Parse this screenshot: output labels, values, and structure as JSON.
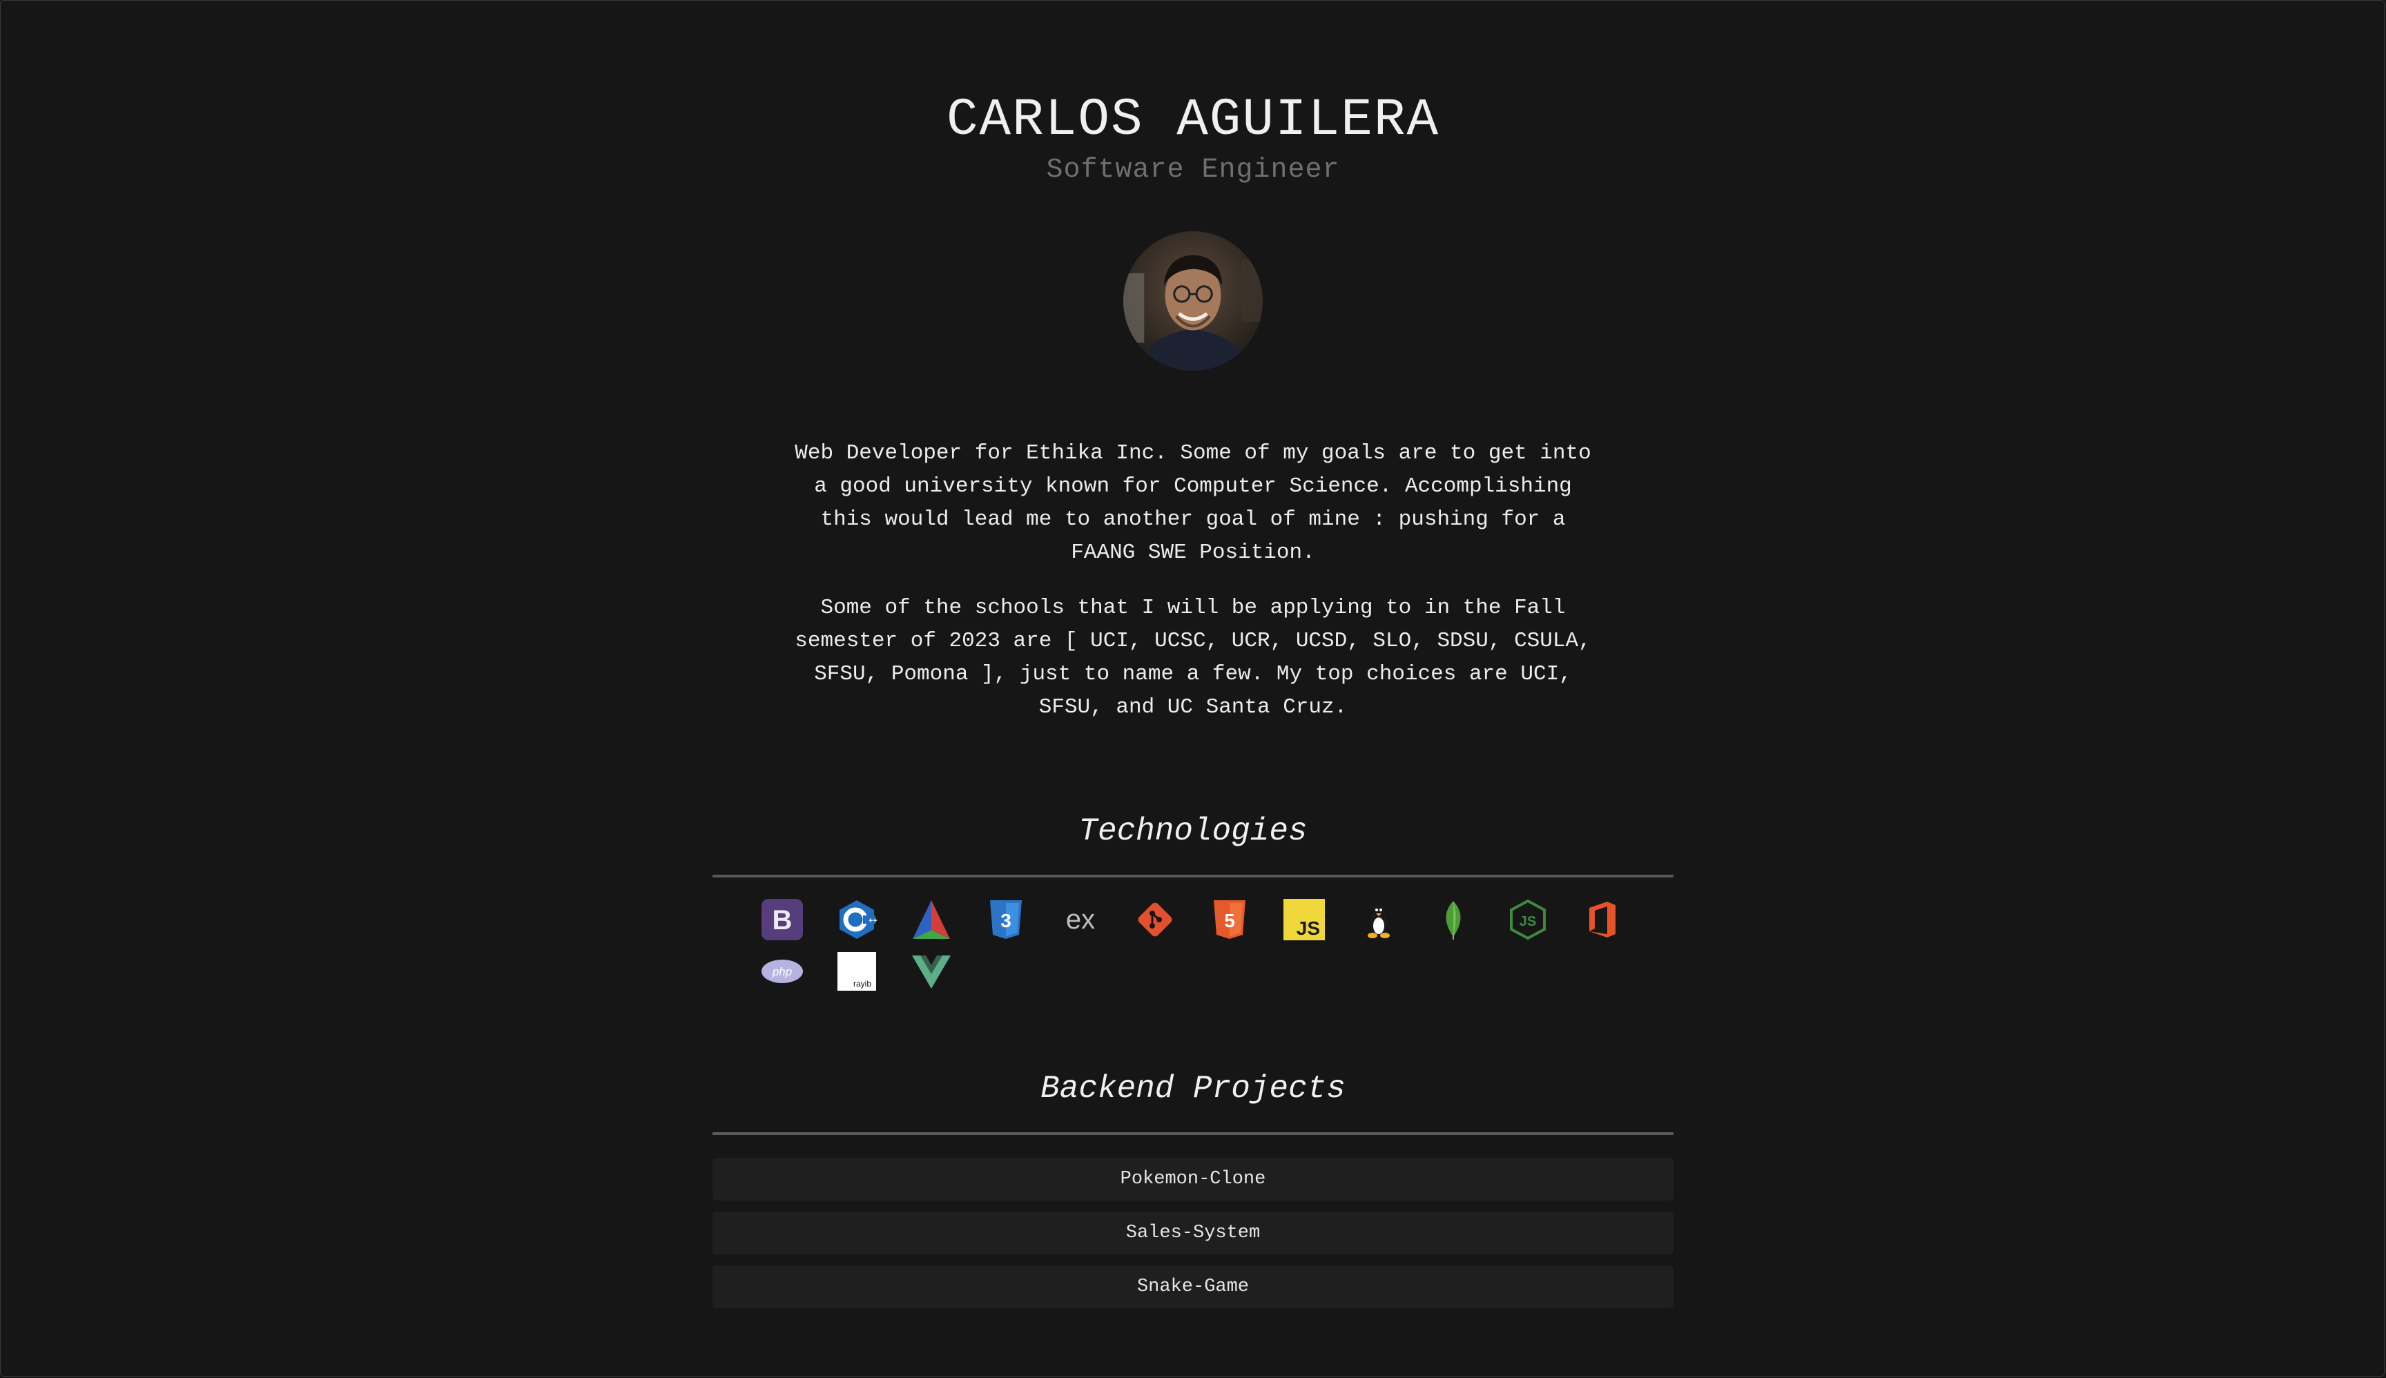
{
  "header": {
    "name": "CARLOS AGUILERA",
    "role": "Software Engineer"
  },
  "avatar": {
    "alt": "Profile photo"
  },
  "bio": {
    "paragraph1": "Web Developer for Ethika Inc. Some of my goals are to get into a good university known for Computer Science. Accomplishing this would lead me to another goal of mine : pushing for a FAANG SWE Position.",
    "paragraph2": "Some of the schools that I will be applying to in the Fall semester of 2023 are [ UCI, UCSC, UCR, UCSD, SLO, SDSU, CSULA, SFSU, Pomona ], just to name a few. My top choices are UCI, SFSU, and UC Santa Cruz."
  },
  "technologies": {
    "title": "Technologies",
    "icons": [
      {
        "name": "bootstrap-icon",
        "label": "B",
        "color": "#563d7c"
      },
      {
        "name": "cplusplus-icon",
        "label": "C++",
        "color": "#1e6fbf"
      },
      {
        "name": "cmake-icon",
        "label": "",
        "color": "#3e8ede"
      },
      {
        "name": "css3-icon",
        "label": "3",
        "color": "#2d74c9"
      },
      {
        "name": "express-icon",
        "label": "ex",
        "color": "#bdbdbd"
      },
      {
        "name": "git-icon",
        "label": "",
        "color": "#e2502e"
      },
      {
        "name": "html5-icon",
        "label": "5",
        "color": "#e55a2b"
      },
      {
        "name": "javascript-icon",
        "label": "JS",
        "color": "#f0d73a"
      },
      {
        "name": "linux-icon",
        "label": "",
        "color": "#ffffff"
      },
      {
        "name": "mongodb-icon",
        "label": "",
        "color": "#4f9b3b"
      },
      {
        "name": "nodejs-icon",
        "label": "JS",
        "color": "#3e8a3e"
      },
      {
        "name": "office-icon",
        "label": "",
        "color": "#e4532a"
      },
      {
        "name": "php-icon",
        "label": "php",
        "color": "#b6b3e0"
      },
      {
        "name": "rayib-icon",
        "label": "rayib",
        "color": "#ffffff"
      },
      {
        "name": "vuejs-icon",
        "label": "",
        "color": "#5bb088"
      }
    ]
  },
  "projects": {
    "title": "Backend Projects",
    "items": [
      {
        "label": "Pokemon-Clone"
      },
      {
        "label": "Sales-System"
      },
      {
        "label": "Snake-Game"
      }
    ]
  }
}
